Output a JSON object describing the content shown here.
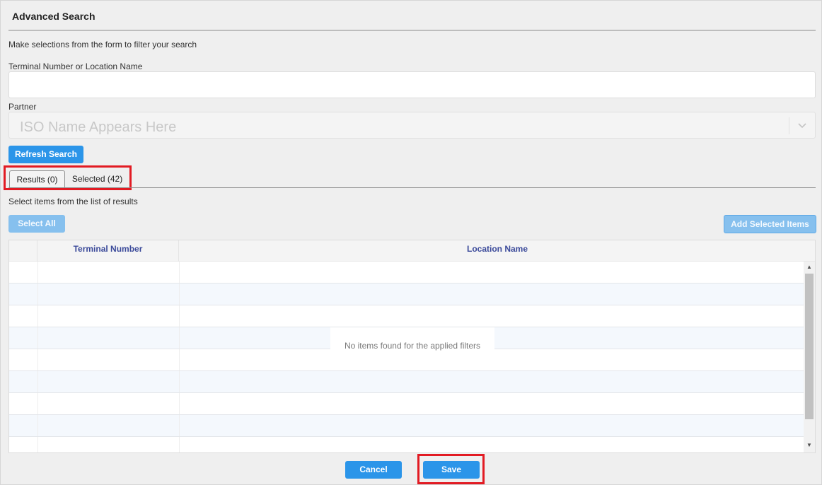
{
  "dialog": {
    "title": "Advanced Search",
    "intro": "Make selections from the form to filter your search"
  },
  "form": {
    "terminal_label": "Terminal Number or Location Name",
    "terminal_value": "",
    "partner_label": "Partner",
    "partner_value": "ISO Name Appears Here",
    "refresh_label": "Refresh Search"
  },
  "tabs": [
    {
      "label": "Results (0)",
      "active": true
    },
    {
      "label": "Selected (42)",
      "active": false
    }
  ],
  "results": {
    "intro": "Select items from the list of results",
    "select_all_label": "Select All",
    "add_selected_label": "Add Selected Items",
    "columns": [
      "Terminal Number",
      "Location Name"
    ],
    "empty_message": "No items found for the applied filters"
  },
  "footer": {
    "cancel_label": "Cancel",
    "save_label": "Save"
  },
  "colors": {
    "primary": "#2b95e9",
    "highlight": "#e21b23",
    "header_text": "#3b4a9a"
  }
}
